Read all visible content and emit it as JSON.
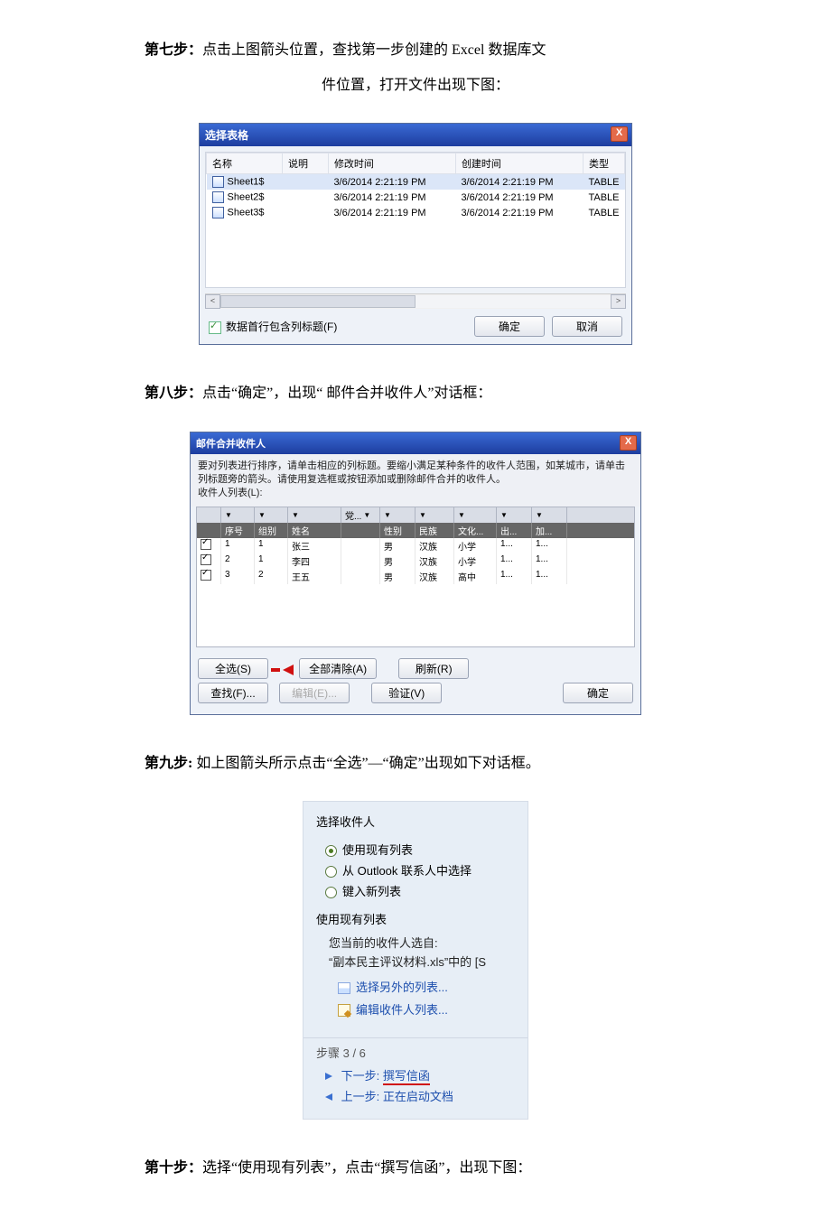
{
  "step7": {
    "label": "第七步：",
    "text_a": "点击上图箭头位置，查找第一步创建的 Excel 数据库文",
    "text_b": "件位置，打开文件出现下图："
  },
  "dlg1": {
    "title": "选择表格",
    "close": "X",
    "columns": [
      "名称",
      "说明",
      "修改时间",
      "创建时间",
      "类型"
    ],
    "rows": [
      {
        "name": "Sheet1$",
        "desc": "",
        "mtime": "3/6/2014 2:21:19 PM",
        "ctime": "3/6/2014 2:21:19 PM",
        "type": "TABLE"
      },
      {
        "name": "Sheet2$",
        "desc": "",
        "mtime": "3/6/2014 2:21:19 PM",
        "ctime": "3/6/2014 2:21:19 PM",
        "type": "TABLE"
      },
      {
        "name": "Sheet3$",
        "desc": "",
        "mtime": "3/6/2014 2:21:19 PM",
        "ctime": "3/6/2014 2:21:19 PM",
        "type": "TABLE"
      }
    ],
    "checkbox_label": "数据首行包含列标题(F)",
    "ok": "确定",
    "cancel": "取消",
    "scroll_left": "<",
    "scroll_right": ">"
  },
  "step8": {
    "label": "第八步：",
    "text": "点击“确定”，出现“ 邮件合并收件人”对话框："
  },
  "dlg2": {
    "title": "邮件合并收件人",
    "desc": "要对列表进行排序，请单击相应的列标题。要缩小满足某种条件的收件人范围，如某城市，请单击列标题旁的箭头。请使用复选框或按钮添加或删除邮件合并的收件人。",
    "list_label": "收件人列表(L):",
    "drop": "▼",
    "c_seq": "序号",
    "c_grp": "组别",
    "c_name": "姓名",
    "c_dang": "党...",
    "c_sex": "性别",
    "c_nation": "民族",
    "c_edu": "文化...",
    "c_chu": "出...",
    "c_jia": "加...",
    "rows": [
      {
        "seq": "1",
        "grp": "1",
        "name": "张三",
        "sex": "男",
        "nation": "汉族",
        "edu": "小学",
        "chu": "1...",
        "jia": "1..."
      },
      {
        "seq": "2",
        "grp": "1",
        "name": "李四",
        "sex": "男",
        "nation": "汉族",
        "edu": "小学",
        "chu": "1...",
        "jia": "1..."
      },
      {
        "seq": "3",
        "grp": "2",
        "name": "王五",
        "sex": "男",
        "nation": "汉族",
        "edu": "高中",
        "chu": "1...",
        "jia": "1..."
      }
    ],
    "btn_selectall": "全选(S)",
    "btn_clearall": "全部清除(A)",
    "btn_refresh": "刷新(R)",
    "btn_find": "查找(F)...",
    "btn_edit": "编辑(E)...",
    "btn_validate": "验证(V)",
    "btn_ok": "确定"
  },
  "step9": {
    "label": "第九步:",
    "text": " 如上图箭头所示点击“全选”—“确定”出现如下对话框。"
  },
  "pane3": {
    "h_select": "选择收件人",
    "opt1": "使用现有列表",
    "opt2": "从 Outlook 联系人中选择",
    "opt3": "键入新列表",
    "h_use": "使用现有列表",
    "sub1": "您当前的收件人选自:",
    "sub2": "“副本民主评议材料.xls”中的 [S",
    "link1": "选择另外的列表...",
    "link2": "编辑收件人列表...",
    "steps": "步骤 3 / 6",
    "next_pre": "下一步: ",
    "next_link": "撰写信函",
    "prev_pre": "上一步: ",
    "prev_link": "正在启动文档"
  },
  "step10": {
    "label": "第十步：",
    "text": "选择“使用现有列表”，点击“撰写信函”，出现下图："
  }
}
